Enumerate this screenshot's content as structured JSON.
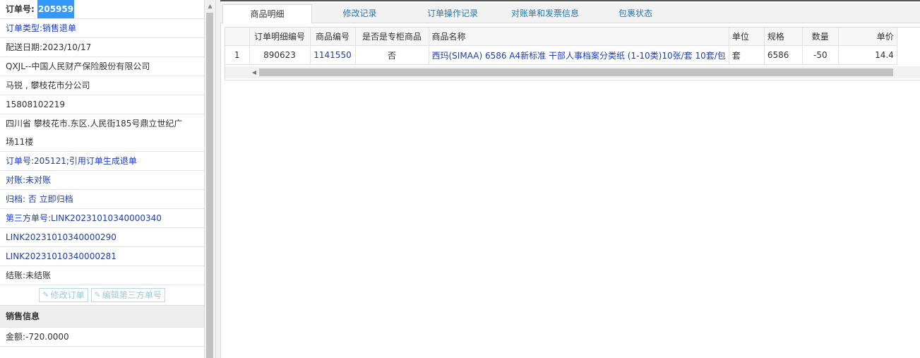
{
  "order": {
    "id_label": "订单号:",
    "id_value": "205959",
    "type": "订单类型:销售退单",
    "delivery_date": "配送日期:2023/10/17",
    "customer": "QXJL--中国人民财产保险股份有限公司",
    "contact": "马锐 , 攀枝花市分公司",
    "phone": "15808102219",
    "address_line1": "四川省 攀枝花市.东区.人民街185号鼎立世纪广",
    "address_line2": "场11楼",
    "ref_order": "订单号:205121;引用订单生成退单",
    "reconcile": "对账:未对账",
    "archive": "归档: 否 立即归档",
    "third_party_1": "第三方单号:LINK20231010340000340",
    "third_party_2": "LINK20231010340000290",
    "third_party_3": "LINK20231010340000281",
    "settlement": "结账:未结账",
    "edit_order_btn": "修改订单",
    "edit_third_party_btn": "编辑第三方单号"
  },
  "sales": {
    "header": "销售信息",
    "amount": "金额:-720.0000"
  },
  "tabs": [
    "商品明细",
    "修改记录",
    "订单操作记录",
    "对账单和发票信息",
    "包裹状态"
  ],
  "table": {
    "columns": [
      "",
      "订单明细编号",
      "商品编号",
      "是否是专柜商品",
      "商品名称",
      "单位",
      "规格",
      "数量",
      "单价"
    ],
    "rows": [
      {
        "row_num": "1",
        "detail_id": "890623",
        "product_id": "1141550",
        "is_counter": "否",
        "name": "西玛(SIMAA) 6586 A4新标准 干部人事档案分类纸 (1-10类)10张/套 10套/包",
        "unit": "套",
        "spec": "6586",
        "qty": "-50",
        "price": "14.4"
      }
    ]
  },
  "colors": {
    "accent": "#1f3db5",
    "highlight": "#3399ff",
    "link": "#1f7ab8"
  },
  "icons": {
    "edit": "edit-icon",
    "scroll_up": "scroll-up-arrow-icon",
    "scroll_left": "scroll-left-arrow-icon"
  }
}
